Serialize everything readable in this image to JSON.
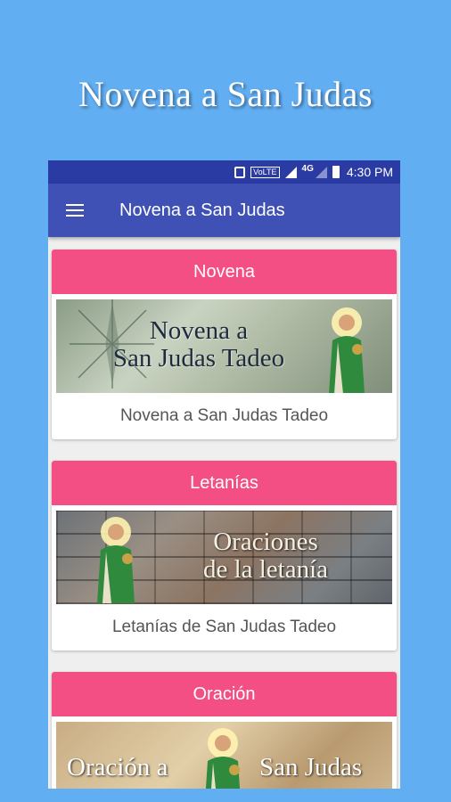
{
  "promo": {
    "title": "Novena a San Judas"
  },
  "statusbar": {
    "volte": "VoLTE",
    "network": "4G",
    "time": "4:30 PM"
  },
  "appbar": {
    "title": "Novena a San Judas"
  },
  "cards": [
    {
      "header": "Novena",
      "image_text": [
        "Novena a",
        "San Judas Tadeo"
      ],
      "caption": "Novena a San Judas Tadeo"
    },
    {
      "header": "Letanías",
      "image_text": [
        "Oraciones",
        "de la letanía"
      ],
      "caption": "Letanías de San Judas Tadeo"
    },
    {
      "header": "Oración",
      "image_text": [
        "Oración a",
        "San Judas"
      ],
      "caption": ""
    }
  ],
  "colors": {
    "background": "#62aef2",
    "statusbar": "#2b3ba4",
    "appbar": "#3f51b5",
    "card_header": "#f34f84"
  }
}
